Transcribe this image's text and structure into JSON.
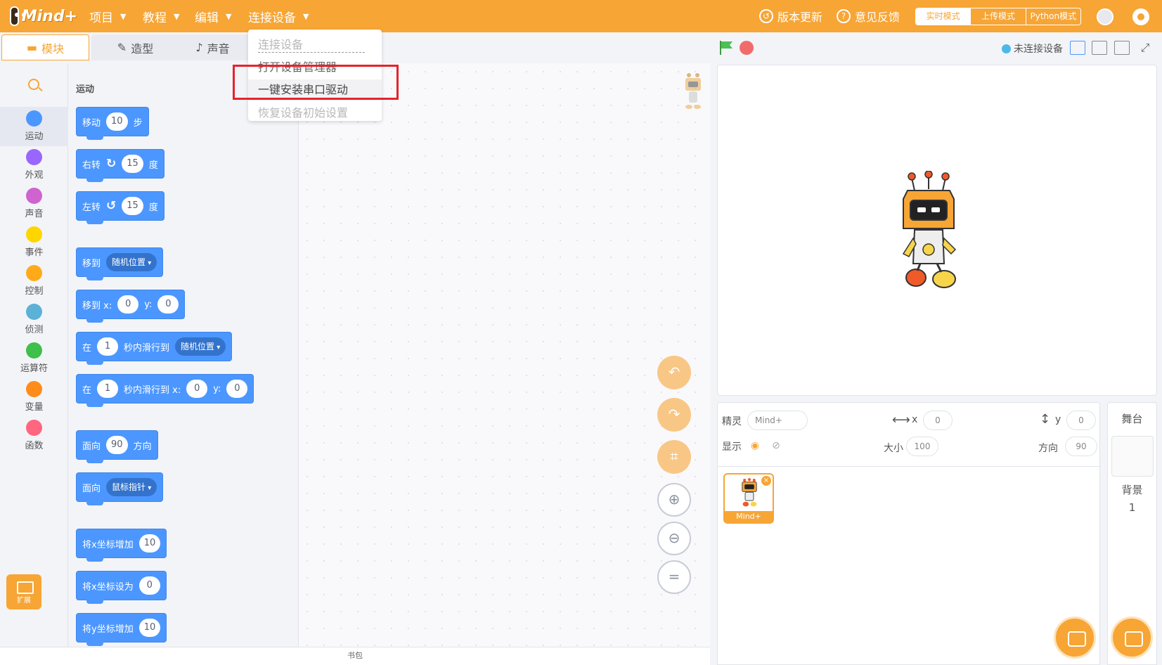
{
  "app": {
    "logo_text": "Mind+"
  },
  "menu": [
    {
      "label": "项目"
    },
    {
      "label": "教程"
    },
    {
      "label": "编辑"
    },
    {
      "label": "连接设备"
    }
  ],
  "topright": {
    "update_label": "版本更新",
    "feedback_label": "意见反馈",
    "modes": [
      {
        "label": "实时模式",
        "active": true
      },
      {
        "label": "上传模式",
        "active": false
      },
      {
        "label": "Python模式",
        "active": false
      }
    ]
  },
  "tabs": [
    {
      "label": "模块",
      "icon": "puzzle-icon",
      "active": true
    },
    {
      "label": "造型",
      "icon": "brush-icon",
      "active": false
    },
    {
      "label": "声音",
      "icon": "speaker-icon",
      "active": false
    }
  ],
  "connection_status": "未连接设备",
  "dropdown": {
    "items": [
      {
        "label": "连接设备",
        "enabled": false
      },
      {
        "label": "打开设备管理器",
        "enabled": true
      },
      {
        "label": "一键安装串口驱动",
        "enabled": true,
        "highlighted": true
      },
      {
        "label": "恢复设备初始设置",
        "enabled": false
      }
    ]
  },
  "categories": [
    {
      "label": "运动",
      "color": "#4c97ff",
      "active": true
    },
    {
      "label": "外观",
      "color": "#9966ff"
    },
    {
      "label": "声音",
      "color": "#cf63cf"
    },
    {
      "label": "事件",
      "color": "#ffd500"
    },
    {
      "label": "控制",
      "color": "#ffab19"
    },
    {
      "label": "侦测",
      "color": "#5cb1d6"
    },
    {
      "label": "运算符",
      "color": "#40bf4a"
    },
    {
      "label": "变量",
      "color": "#ff8c1a"
    },
    {
      "label": "函数",
      "color": "#ff6680"
    }
  ],
  "extension_label": "扩展",
  "palette": {
    "title": "运动",
    "blocks": {
      "move": {
        "a": "移动",
        "v": "10",
        "b": "步"
      },
      "turn_right": {
        "a": "右转",
        "v": "15",
        "b": "度"
      },
      "turn_left": {
        "a": "左转",
        "v": "15",
        "b": "度"
      },
      "goto": {
        "a": "移到",
        "d": "随机位置"
      },
      "goto_xy": {
        "a": "移到 x:",
        "x": "0",
        "yl": "y:",
        "y": "0"
      },
      "glide": {
        "a": "在",
        "v": "1",
        "b": "秒内滑行到",
        "d": "随机位置"
      },
      "glide_xy": {
        "a": "在",
        "v": "1",
        "b": "秒内滑行到 x:",
        "x": "0",
        "yl": "y:",
        "y": "0"
      },
      "point_dir": {
        "a": "面向",
        "v": "90",
        "b": "方向"
      },
      "point_towards": {
        "a": "面向",
        "d": "鼠标指针"
      },
      "change_x": {
        "a": "将x坐标增加",
        "v": "10"
      },
      "set_x": {
        "a": "将x坐标设为",
        "v": "0"
      },
      "change_y": {
        "a": "将y坐标增加",
        "v": "10"
      }
    }
  },
  "backpack_label": "书包",
  "sprite": {
    "sprite_label": "精灵",
    "name": "Mind+",
    "x_label": "x",
    "x": "0",
    "y_label": "y",
    "y": "0",
    "show_label": "显示",
    "size_label": "大小",
    "size": "100",
    "direction_label": "方向",
    "direction": "90",
    "thumb_name": "Mind+"
  },
  "stage_side": {
    "title": "舞台",
    "backdrop_label": "背景",
    "backdrop_count": "1"
  }
}
